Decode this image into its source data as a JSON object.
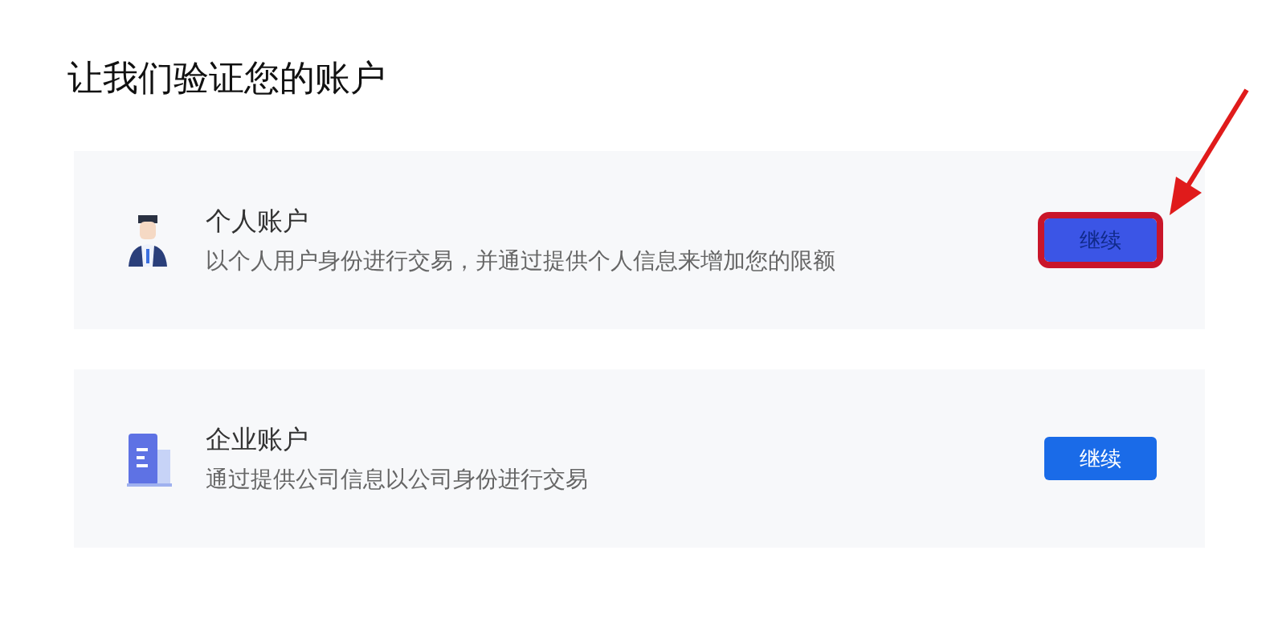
{
  "title": "让我们验证您的账户",
  "accounts": [
    {
      "kind": "personal",
      "name": "个人账户",
      "description": "以个人用户身份进行交易，并通过提供个人信息来增加您的限额",
      "button": "继续",
      "highlighted": true
    },
    {
      "kind": "business",
      "name": "企业账户",
      "description": "通过提供公司信息以公司身份进行交易",
      "button": "继续",
      "highlighted": false
    }
  ]
}
